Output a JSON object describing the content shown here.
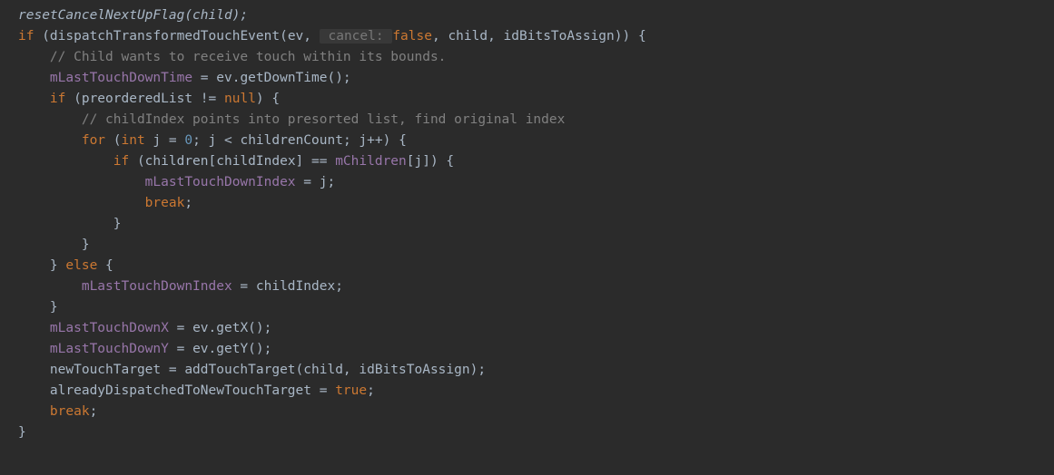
{
  "code": {
    "l1_call": "resetCancelNextUpFlag",
    "l1_arg": "(child);",
    "l2_if": "if",
    "l2_a": " (dispatchTransformedTouchEvent(ev, ",
    "l2_hint_label": " cancel: ",
    "l2_hint_val": "false",
    "l2_b": ", child, idBitsToAssign)) {",
    "l3": "    // Child wants to receive touch within its bounds.",
    "l4_field": "    mLastTouchDownTime",
    "l4_rest": " = ev.getDownTime();",
    "l5_if": "    if",
    "l5_a": " (preorderedList != ",
    "l5_null": "null",
    "l5_b": ") {",
    "l6": "        // childIndex points into presorted list, find original index",
    "l7_for": "        for",
    "l7_a": " (",
    "l7_int": "int",
    "l7_b": " j = ",
    "l7_zero": "0",
    "l7_c": "; j < childrenCount; j++) {",
    "l8_if": "            if",
    "l8_a": " (children[childIndex] == ",
    "l8_field": "mChildren",
    "l8_b": "[j]) {",
    "l9_field": "                mLastTouchDownIndex",
    "l9_rest": " = j;",
    "l10_break": "                break",
    "l10_semi": ";",
    "l11": "            }",
    "l12": "        }",
    "l13_a": "    } ",
    "l13_else": "else",
    "l13_b": " {",
    "l14_field": "        mLastTouchDownIndex",
    "l14_rest": " = childIndex;",
    "l15": "    }",
    "l16_field": "    mLastTouchDownX",
    "l16_rest": " = ev.getX();",
    "l17_field": "    mLastTouchDownY",
    "l17_rest": " = ev.getY();",
    "l18": "    newTouchTarget = addTouchTarget(child, idBitsToAssign);",
    "l19_a": "    alreadyDispatchedToNewTouchTarget = ",
    "l19_true": "true",
    "l19_b": ";",
    "l20_break": "    break",
    "l20_semi": ";",
    "l21": "}"
  }
}
